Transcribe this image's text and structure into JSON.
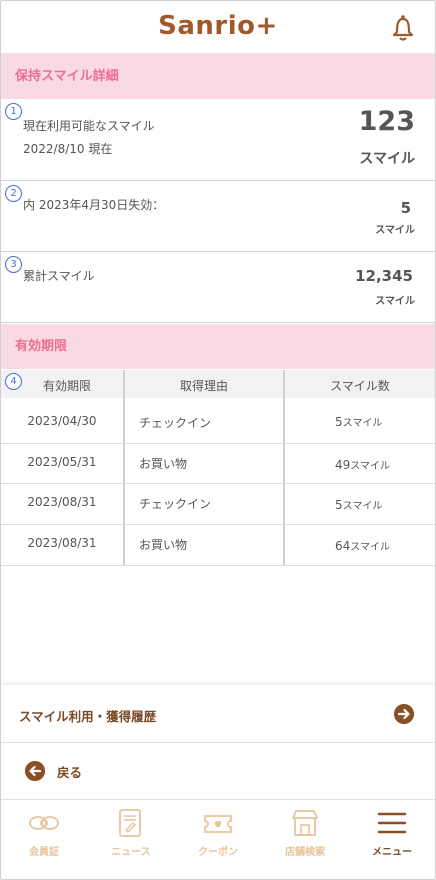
{
  "header": {
    "logo": "Sanrio+",
    "bell_icon": "bell-icon"
  },
  "section1": {
    "title": "保持スマイル詳細"
  },
  "row1": {
    "marker": "1",
    "label": "現在利用可能なスマイル",
    "date": "2022/8/10 現在",
    "value": "123",
    "unit": "スマイル"
  },
  "row2": {
    "marker": "2",
    "label": "内 2023年4月30日失効：",
    "value": "5",
    "unit": "スマイル"
  },
  "row3": {
    "marker": "3",
    "label": "累計スマイル",
    "value": "12,345",
    "unit": "スマイル"
  },
  "section2": {
    "title": "有効期限"
  },
  "table": {
    "marker": "4",
    "headers": [
      "有効期限",
      "取得理由",
      "スマイル数"
    ],
    "rows": [
      {
        "date": "2023/04/30",
        "reason": "チェックイン",
        "num": "5",
        "unit": "スマイル"
      },
      {
        "date": "2023/05/31",
        "reason": "お買い物",
        "num": "49",
        "unit": "スマイル"
      },
      {
        "date": "2023/08/31",
        "reason": "チェックイン",
        "num": "5",
        "unit": "スマイル"
      },
      {
        "date": "2023/08/31",
        "reason": "お買い物",
        "num": "64",
        "unit": "スマイル"
      }
    ]
  },
  "history": {
    "label": "スマイル利用・獲得履歴"
  },
  "back": {
    "label": "戻る"
  },
  "tabs": [
    {
      "label": "会員証",
      "icon": "ribbon-card-icon",
      "active": false
    },
    {
      "label": "ニュース",
      "icon": "news-icon",
      "active": false
    },
    {
      "label": "クーポン",
      "icon": "coupon-icon",
      "active": false
    },
    {
      "label": "店舗検索",
      "icon": "store-icon",
      "active": false
    },
    {
      "label": "メニュー",
      "icon": "menu-icon",
      "active": true
    }
  ],
  "colors": {
    "brand": "#a0592c",
    "pink_header": "#f9dae4",
    "pink_text": "#ec6f92",
    "marker_blue": "#4b6bd5",
    "tab_inactive": "#e8c39a"
  }
}
